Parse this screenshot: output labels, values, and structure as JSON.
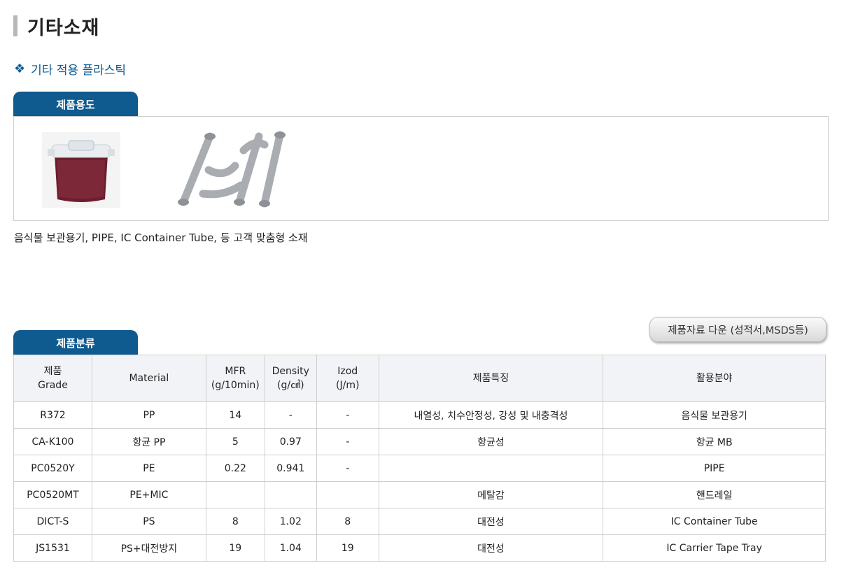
{
  "page": {
    "title": "기타소재",
    "section_title": "기타 적용 플라스틱"
  },
  "usage": {
    "tab_label": "제품용도",
    "images": [
      {
        "name": "food-container",
        "color": "#6b1f2e"
      },
      {
        "name": "pipe-set",
        "color": "#a9adb2"
      }
    ],
    "description": "음식물 보관용기, PIPE, IC Container Tube, 등 고객 맞춤형 소재"
  },
  "classification": {
    "tab_label": "제품분류",
    "download_label": "제품자료 다운 (성적서,MSDS등)",
    "headers": [
      {
        "line1": "제품",
        "line2": "Grade"
      },
      {
        "line1": "Material",
        "line2": ""
      },
      {
        "line1": "MFR",
        "line2": "(g/10min)"
      },
      {
        "line1": "Density",
        "line2": "(g/㎤)"
      },
      {
        "line1": "Izod",
        "line2": "(J/m)"
      },
      {
        "line1": "제품특징",
        "line2": ""
      },
      {
        "line1": "활용분야",
        "line2": ""
      }
    ],
    "rows": [
      [
        "R372",
        "PP",
        "14",
        "-",
        "-",
        "내열성, 치수안정성, 강성 및 내충격성",
        "음식물 보관용기"
      ],
      [
        "CA-K100",
        "항균 PP",
        "5",
        "0.97",
        "-",
        "항균성",
        "항균 MB"
      ],
      [
        "PC0520Y",
        "PE",
        "0.22",
        "0.941",
        "-",
        "",
        "PIPE"
      ],
      [
        "PC0520MT",
        "PE+MIC",
        "",
        "",
        "",
        "메탈감",
        "핸드레일"
      ],
      [
        "DICT-S",
        "PS",
        "8",
        "1.02",
        "8",
        "대전성",
        "IC Container Tube"
      ],
      [
        "JS1531",
        "PS+대전방지",
        "19",
        "1.04",
        "19",
        "대전성",
        "IC Carrier Tape Tray"
      ]
    ]
  }
}
